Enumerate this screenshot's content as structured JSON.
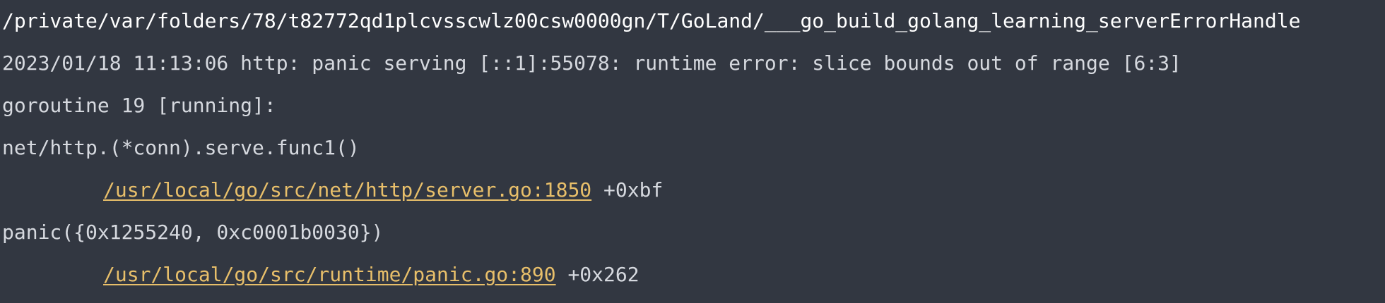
{
  "console": {
    "command_path": "/private/var/folders/78/t82772qd1plcvsscwlz00csw0000gn/T/GoLand/___go_build_golang_learning_serverErrorHandle",
    "panic_line": "2023/01/18 11:13:06 http: panic serving [::1]:55078: runtime error: slice bounds out of range [6:3]",
    "goroutine_line": "goroutine 19 [running]:",
    "frames": [
      {
        "func": "net/http.(*conn).serve.func1()",
        "file": "/usr/local/go/src/net/http/server.go:1850",
        "offset": " +0xbf"
      },
      {
        "func": "panic({0x1255240, 0xc0001b0030})",
        "file": "/usr/local/go/src/runtime/panic.go:890",
        "offset": " +0x262"
      }
    ]
  },
  "colors": {
    "background": "#323741",
    "text": "#d6d9df",
    "link": "#e8bf6a"
  }
}
